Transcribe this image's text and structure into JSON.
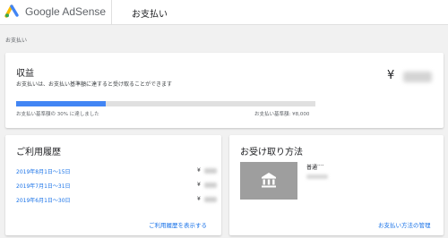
{
  "header": {
    "logo_text": "Google AdSense",
    "page_title": "お支払い"
  },
  "breadcrumb": "お支払い",
  "earnings": {
    "title": "収益",
    "description": "お支払いは、お支払い基準額に達すると受け取ることができます",
    "currency_symbol": "¥",
    "progress_fraction": 0.3,
    "progress_text": "お支払い基準額の 30% に達しました",
    "threshold_text": "お支払い基準額: ¥8,000",
    "progress_color": "#4285f4"
  },
  "history": {
    "title": "ご利用履歴",
    "rows": [
      {
        "period": "2019年8月1日～15日",
        "currency": "¥"
      },
      {
        "period": "2019年7月1日～31日",
        "currency": "¥"
      },
      {
        "period": "2019年6月1日～30日",
        "currency": "¥"
      }
    ],
    "footer_link": "ご利用履歴を表示する"
  },
  "payment_method": {
    "title": "お受け取り方法",
    "account_type": "普通",
    "account_mask": "····",
    "bank_icon": "bank-icon",
    "footer_link": "お支払い方法の管理"
  },
  "colors": {
    "link": "#1a73e8",
    "logo_yellow": "#fbbc04",
    "logo_blue": "#4285f4",
    "logo_green": "#34a853"
  }
}
